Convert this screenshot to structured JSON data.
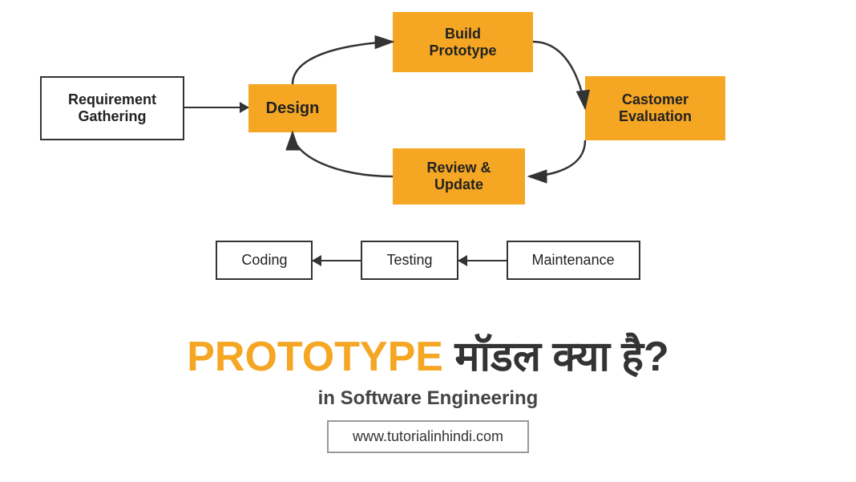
{
  "diagram": {
    "req_label": "Requirement\nGathering",
    "design_label": "Design",
    "build_label": "Build\nPrototype",
    "customer_label": "Castomer\nEvaluation",
    "review_label": "Review &\nUpdate",
    "maintenance_label": "Maintenance",
    "testing_label": "Testing",
    "coding_label": "Coding"
  },
  "title": {
    "part1": "PROTOTYPE ",
    "part2": "मॉडल ",
    "part3": "क्या है?",
    "subtitle": "in Software Engineering",
    "website": "www.tutorialinhindi.com"
  }
}
